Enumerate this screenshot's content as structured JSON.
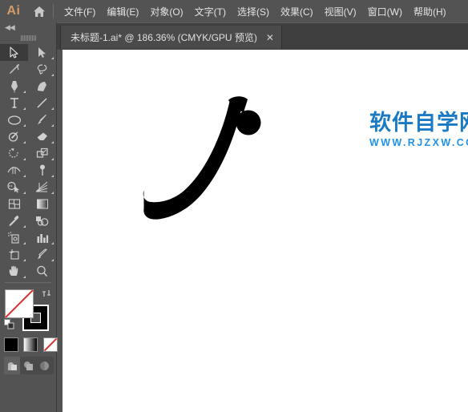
{
  "app": {
    "logo_text": "Ai",
    "home_icon": "home-icon"
  },
  "menubar": {
    "items": [
      {
        "label": "文件(F)",
        "name": "menu-file"
      },
      {
        "label": "编辑(E)",
        "name": "menu-edit"
      },
      {
        "label": "对象(O)",
        "name": "menu-object"
      },
      {
        "label": "文字(T)",
        "name": "menu-type"
      },
      {
        "label": "选择(S)",
        "name": "menu-select"
      },
      {
        "label": "效果(C)",
        "name": "menu-effect"
      },
      {
        "label": "视图(V)",
        "name": "menu-view"
      },
      {
        "label": "窗口(W)",
        "name": "menu-window"
      },
      {
        "label": "帮助(H)",
        "name": "menu-help"
      }
    ]
  },
  "tabs": {
    "active": {
      "label": "未标题-1.ai* @ 186.36% (CMYK/GPU 预览)",
      "close_label": "✕",
      "document_name": "未标题-1.ai",
      "modified": "*",
      "zoom": "186.36%",
      "color_mode": "CMYK",
      "preview_mode": "GPU 预览"
    }
  },
  "toolpanel": {
    "collapse_label": "◀◀",
    "tools": [
      {
        "name": "selection-tool",
        "selected": true
      },
      {
        "name": "direct-selection-tool",
        "selected": false
      },
      {
        "name": "magic-wand-tool",
        "selected": false
      },
      {
        "name": "lasso-tool",
        "selected": false
      },
      {
        "name": "pen-tool",
        "selected": false
      },
      {
        "name": "curvature-tool",
        "selected": false
      },
      {
        "name": "type-tool",
        "selected": false
      },
      {
        "name": "line-segment-tool",
        "selected": false
      },
      {
        "name": "ellipse-tool",
        "selected": false
      },
      {
        "name": "paintbrush-tool",
        "selected": false
      },
      {
        "name": "shaper-tool",
        "selected": false
      },
      {
        "name": "eraser-tool",
        "selected": false
      },
      {
        "name": "rotate-tool",
        "selected": false
      },
      {
        "name": "scale-tool",
        "selected": false
      },
      {
        "name": "width-tool",
        "selected": false
      },
      {
        "name": "free-transform-tool",
        "selected": false
      },
      {
        "name": "shape-builder-tool",
        "selected": false
      },
      {
        "name": "perspective-grid-tool",
        "selected": false
      },
      {
        "name": "mesh-tool",
        "selected": false
      },
      {
        "name": "gradient-tool",
        "selected": false
      },
      {
        "name": "eyedropper-tool",
        "selected": false
      },
      {
        "name": "blend-tool",
        "selected": false
      },
      {
        "name": "symbol-sprayer-tool",
        "selected": false
      },
      {
        "name": "column-graph-tool",
        "selected": false
      },
      {
        "name": "artboard-tool",
        "selected": false
      },
      {
        "name": "slice-tool",
        "selected": false
      },
      {
        "name": "hand-tool",
        "selected": false
      },
      {
        "name": "zoom-tool",
        "selected": false
      }
    ],
    "fill_stroke": {
      "fill": "none",
      "fill_color": "#ffffff",
      "stroke_color": "#000000",
      "swap_icon": "swap-fill-stroke-icon",
      "default_icon": "default-fill-stroke-icon"
    },
    "color_modes": [
      {
        "name": "color-mode-button",
        "value": "#000000"
      },
      {
        "name": "gradient-mode-button",
        "value": "gradient"
      },
      {
        "name": "none-mode-button",
        "value": "none"
      }
    ],
    "draw_modes": [
      {
        "name": "draw-normal-button",
        "active": true
      },
      {
        "name": "draw-behind-button",
        "active": false
      },
      {
        "name": "draw-inside-button",
        "active": false
      }
    ]
  },
  "canvas": {
    "background": "#ffffff",
    "artwork_name": "tapered-j-curve-stroke",
    "artwork_color": "#000000"
  },
  "watermark": {
    "title": "软件自学网",
    "url": "WWW.RJZXW.COM",
    "title_color": "#1b7ac4",
    "url_color": "#1f92e8"
  }
}
